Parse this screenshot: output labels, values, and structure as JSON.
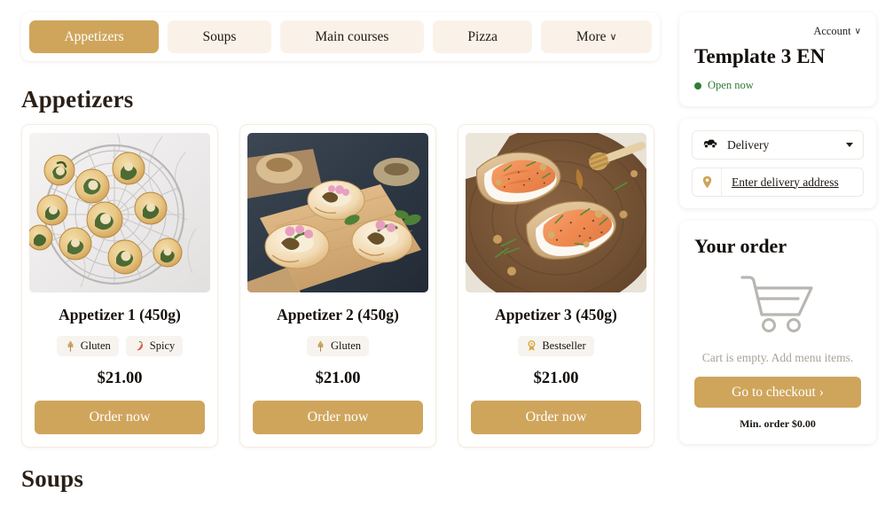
{
  "colors": {
    "accent": "#cfa55c",
    "tab_inactive": "#faf2e8",
    "heading": "#2a1f17",
    "open_green": "#2e7d32",
    "muted": "#a9a29a"
  },
  "tabs": [
    {
      "label": "Appetizers",
      "active": true,
      "has_chevron": false
    },
    {
      "label": "Soups",
      "active": false,
      "has_chevron": false
    },
    {
      "label": "Main courses",
      "active": false,
      "has_chevron": false
    },
    {
      "label": "Pizza",
      "active": false,
      "has_chevron": false
    },
    {
      "label": "More",
      "active": false,
      "has_chevron": true,
      "chevron": "∨"
    }
  ],
  "sections": [
    {
      "heading": "Appetizers"
    },
    {
      "heading": "Soups"
    }
  ],
  "cards": [
    {
      "title": "Appetizer 1 (450g)",
      "price": "$21.00",
      "order_label": "Order now",
      "photo": "spinach-pinwheels-on-wire-rack",
      "badges": [
        {
          "label": "Gluten",
          "icon": "wheat-icon"
        },
        {
          "label": "Spicy",
          "icon": "chili-pepper-icon"
        }
      ]
    },
    {
      "title": "Appetizer 2 (450g)",
      "price": "$21.00",
      "order_label": "Order now",
      "photo": "mini-galettes-on-wood-board",
      "badges": [
        {
          "label": "Gluten",
          "icon": "wheat-icon"
        }
      ]
    },
    {
      "title": "Appetizer 3 (450g)",
      "price": "$21.00",
      "order_label": "Order now",
      "photo": "salmon-toasts-on-dark-wood",
      "badges": [
        {
          "label": "Bestseller",
          "icon": "award-medal-icon"
        }
      ]
    }
  ],
  "sidebar": {
    "account_label": "Account",
    "account_chevron": "∨",
    "brand_title": "Template 3 EN",
    "open_status": "Open now",
    "delivery": {
      "mode_label": "Delivery",
      "mode_icon": "car-icon",
      "address_label": "Enter delivery address",
      "address_icon": "map-pin-icon"
    },
    "order": {
      "title": "Your order",
      "cart_icon": "shopping-cart-icon",
      "empty_text": "Cart is empty. Add menu items.",
      "checkout_label": "Go to checkout ›",
      "min_order": "Min. order $0.00"
    }
  }
}
